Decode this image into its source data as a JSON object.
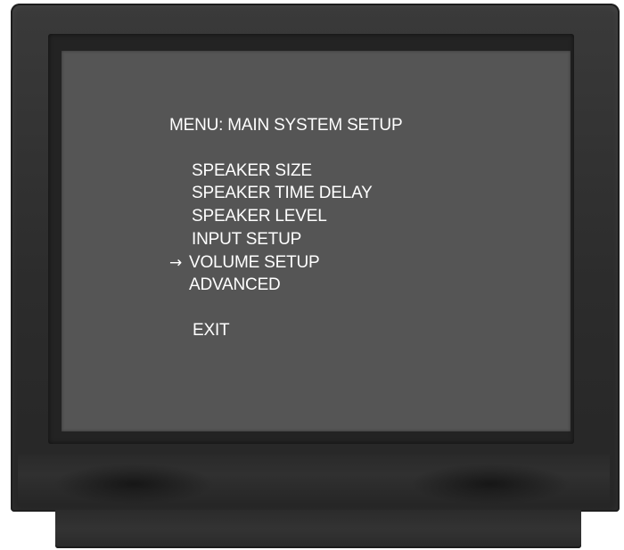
{
  "osd": {
    "title": "MENU: MAIN SYSTEM SETUP",
    "items": [
      {
        "label": "SPEAKER SIZE"
      },
      {
        "label": "SPEAKER TIME DELAY"
      },
      {
        "label": "SPEAKER LEVEL"
      },
      {
        "label": "INPUT SETUP"
      },
      {
        "label": "VOLUME SETUP",
        "selected": true
      },
      {
        "label": "ADVANCED"
      }
    ],
    "exit_label": "EXIT",
    "cursor_icon": "right-arrow-icon",
    "selected_index": 4
  },
  "colors": {
    "screen": "#555555",
    "text": "#ffffff",
    "tv_body": "#2e2e2e"
  }
}
